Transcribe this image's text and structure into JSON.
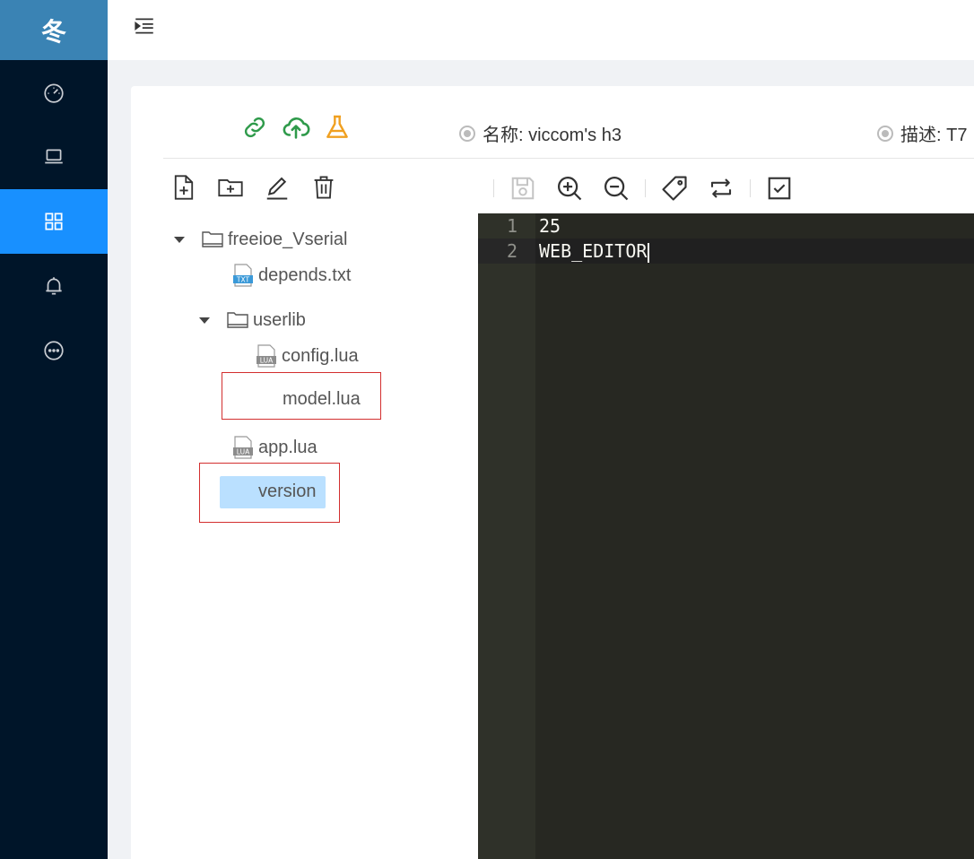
{
  "sidebar": {
    "logo": "冬",
    "items": [
      {
        "icon": "dashboard-icon"
      },
      {
        "icon": "laptop-icon"
      },
      {
        "icon": "appstore-icon",
        "active": true
      },
      {
        "icon": "bell-icon"
      },
      {
        "icon": "message-icon"
      }
    ],
    "active_color": "#1890ff"
  },
  "header": {
    "toggle_icon": "menu-unfold-icon"
  },
  "device_info": {
    "name": "名称: viccom's h3",
    "description": "描述: T7"
  },
  "tree_toolbar": [
    "new-file-icon",
    "new-folder-icon",
    "rename-icon",
    "delete-icon"
  ],
  "tree": {
    "root": "freeioe_Vserial",
    "files": [
      {
        "name": "depends.txt",
        "type": "TXT"
      },
      {
        "name": "userlib",
        "type": "folder"
      },
      {
        "name": "config.lua",
        "type": "LUA"
      },
      {
        "name": "model.lua",
        "type": "LUA"
      },
      {
        "name": "app.lua",
        "type": "LUA"
      },
      {
        "name": "version",
        "type": "file",
        "selected": true
      }
    ]
  },
  "editor": {
    "lines": [
      {
        "num": "1",
        "text": "25"
      },
      {
        "num": "2",
        "text": "WEB_EDITOR"
      }
    ]
  }
}
